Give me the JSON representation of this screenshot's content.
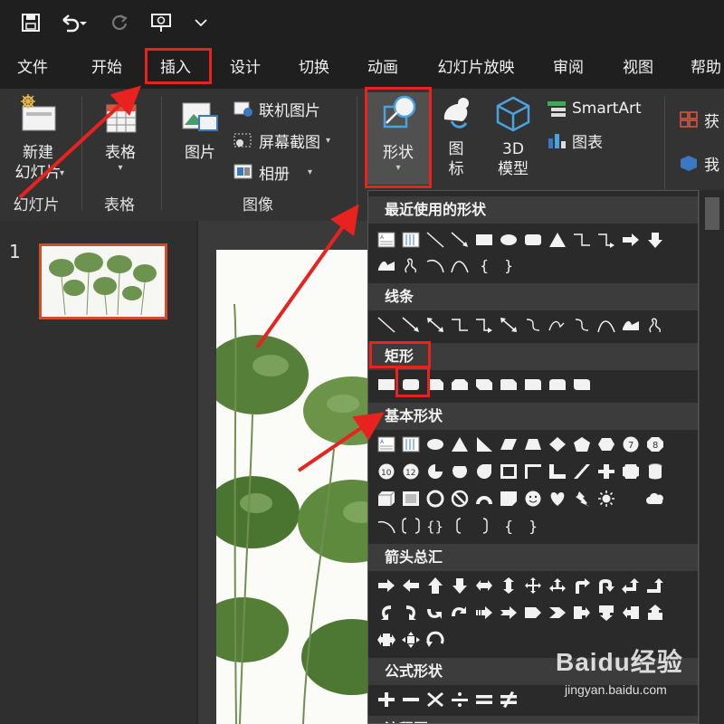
{
  "menu_tabs": [
    "文件",
    "开始",
    "插入",
    "设计",
    "切换",
    "动画",
    "幻灯片放映",
    "审阅",
    "视图",
    "帮助"
  ],
  "ribbon": {
    "slides_group": {
      "new_slide": "新建\n幻灯片",
      "label": "幻灯片"
    },
    "table_group": {
      "table": "表格",
      "label": "表格"
    },
    "images_group": {
      "picture": "图片",
      "online_pictures": "联机图片",
      "screenshot": "屏幕截图",
      "album": "相册",
      "label": "图像"
    },
    "illustrations": {
      "shapes": "形状",
      "icons": "图\n标",
      "models_3d": "3D\n模型",
      "smartart": "SmartArt",
      "chart": "图表"
    },
    "addins": {
      "get": "获",
      "mine": "我"
    }
  },
  "slide_panel": {
    "slide_number": "1"
  },
  "shapes_panel": {
    "sections": [
      "最近使用的形状",
      "线条",
      "矩形",
      "基本形状",
      "箭头总汇",
      "公式形状",
      "流程图"
    ]
  },
  "watermark": {
    "brand": "Baidu经验",
    "url": "jingyan.baidu.com"
  },
  "colors": {
    "accent_red": "#e8231f",
    "dark_bg": "#1f1f1f",
    "ribbon_bg": "#333333",
    "panel_bg": "#2a2a2a"
  }
}
